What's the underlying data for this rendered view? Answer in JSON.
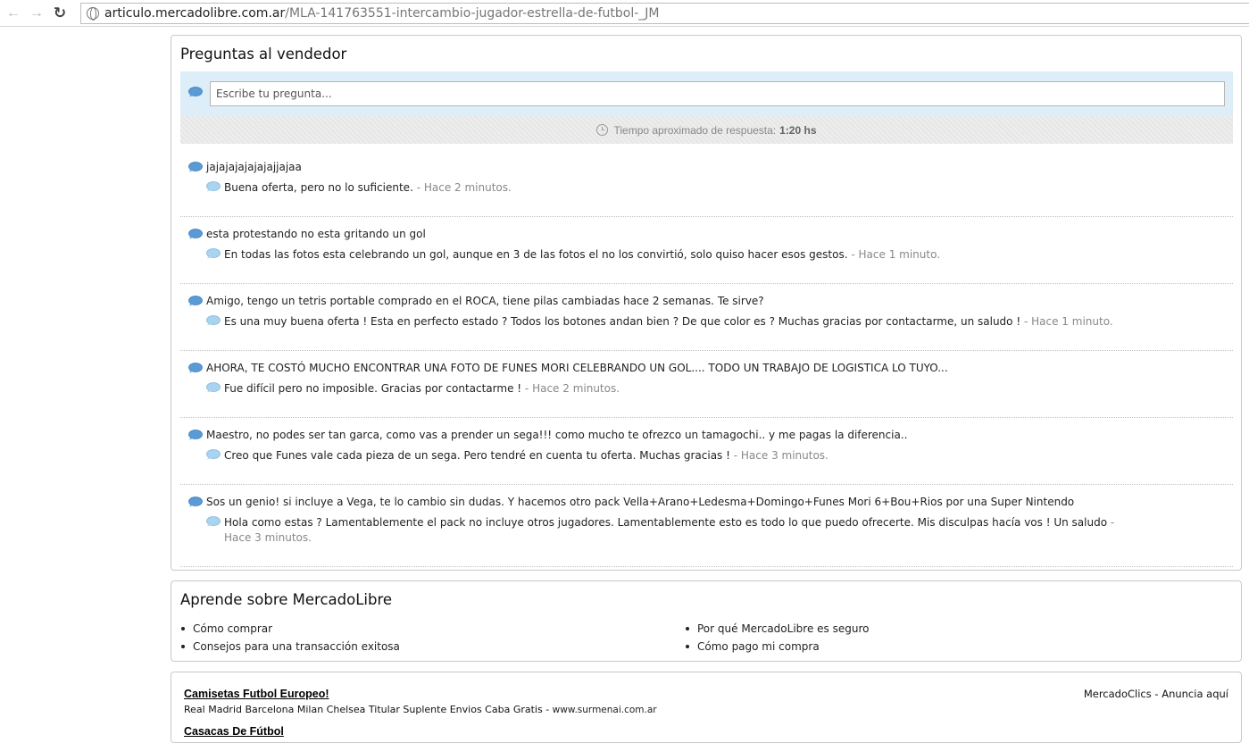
{
  "browser": {
    "url_domain": "articulo.mercadolibre.com.ar",
    "url_path": "/MLA-141763551-intercambio-jugador-estrella-de-futbol-_JM"
  },
  "questions": {
    "title": "Preguntas al vendedor",
    "input_placeholder": "Escribe tu pregunta...",
    "response_label": "Tiempo aproximado de respuesta:",
    "response_value": "1:20 hs",
    "items": [
      {
        "question": "jajajajajajajajjajaa",
        "answer": "Buena oferta, pero no lo suficiente.",
        "time": "- Hace 2 minutos."
      },
      {
        "question": "esta protestando no esta gritando un gol",
        "answer": "En todas las fotos esta celebrando un gol, aunque en 3 de las fotos el no los convirtió, solo quiso hacer esos gestos.",
        "time": "- Hace 1 minuto."
      },
      {
        "question": "Amigo, tengo un tetris portable comprado en el ROCA, tiene pilas cambiadas hace 2 semanas. Te sirve?",
        "answer": "Es una muy buena oferta ! Esta en perfecto estado ? Todos los botones andan bien ? De que color es ? Muchas gracias por contactarme, un saludo !",
        "time": "- Hace 1 minuto."
      },
      {
        "question": "AHORA, TE COSTÓ MUCHO ENCONTRAR UNA FOTO DE FUNES MORI CELEBRANDO UN GOL.... TODO UN TRABAJO DE LOGISTICA LO TUYO...",
        "answer": "Fue difícil pero no imposible. Gracias por contactarme !",
        "time": "- Hace 2 minutos."
      },
      {
        "question": "Maestro, no podes ser tan garca, como vas a prender un sega!!! como mucho te ofrezco un tamagochi.. y me pagas la diferencia..",
        "answer": "Creo que Funes vale cada pieza de un sega. Pero tendré en cuenta tu oferta. Muchas gracias !",
        "time": "- Hace 3 minutos."
      },
      {
        "question": "Sos un genio! si incluye a Vega, te lo cambio sin dudas. Y hacemos otro pack Vella+Arano+Ledesma+Domingo+Funes Mori 6+Bou+Rios por una Super Nintendo",
        "answer": "Hola como estas ? Lamentablemente el pack no incluye otros jugadores. Lamentablemente esto es todo lo que puedo ofrecerte. Mis disculpas hacía vos ! Un saludo",
        "time": "- Hace 3 minutos."
      }
    ]
  },
  "learn": {
    "title": "Aprende sobre MercadoLibre",
    "left_links": [
      "Cómo comprar",
      "Consejos para una transacción exitosa"
    ],
    "right_links": [
      "Por qué MercadoLibre es seguro",
      "Cómo pago mi compra"
    ]
  },
  "ads": {
    "right_label": "MercadoClics - Anuncia aquí",
    "items": [
      {
        "title": "Camisetas Futbol Europeo!",
        "desc": "Real Madrid Barcelona Milan Chelsea Titular Suplente Envios Caba Gratis -",
        "url": "www.surmenai.com.ar"
      },
      {
        "title": "Casacas De Fútbol"
      }
    ]
  },
  "colors": {
    "ask_bg": "#ddeef9",
    "bubble_dark": "#5b9bd5",
    "bubble_light": "#a9d3ee"
  }
}
